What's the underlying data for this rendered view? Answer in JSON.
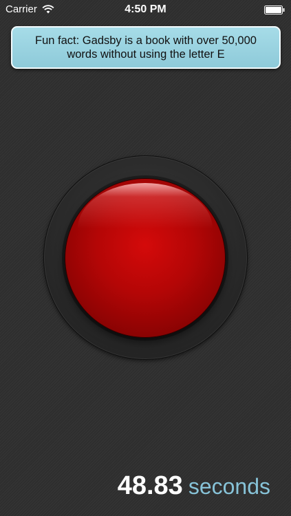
{
  "status_bar": {
    "carrier": "Carrier",
    "time": "4:50 PM",
    "wifi_icon": "wifi-icon",
    "battery_icon": "battery-icon"
  },
  "fact": {
    "text": "Fun fact: Gadsby is a book with over 50,000 words without using the letter E"
  },
  "button": {
    "icon": "big-red-button",
    "color": "#c00808"
  },
  "timer": {
    "value": "48.83",
    "unit": "seconds",
    "unit_color": "#87c3d8"
  }
}
